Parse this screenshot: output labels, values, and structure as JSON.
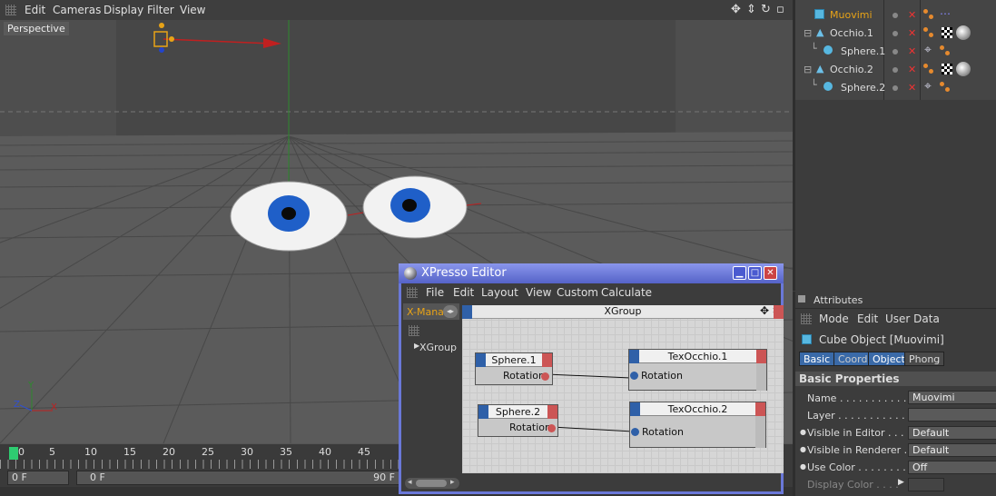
{
  "viewport": {
    "menu": [
      "Edit",
      "Cameras",
      "Display",
      "Filter",
      "View"
    ],
    "label": "Perspective"
  },
  "timeline": {
    "ticks": [
      "0",
      "5",
      "10",
      "15",
      "20",
      "25",
      "30",
      "35",
      "40",
      "45"
    ],
    "current_frame": "0 F",
    "start_frame": "0 F",
    "end_frame": "90 F"
  },
  "object_manager": {
    "objects": [
      {
        "name": "Muovimi",
        "type": "cube",
        "highlight": true
      },
      {
        "name": "Occhio.1",
        "type": "cone"
      },
      {
        "name": "Sphere.1",
        "type": "sphere"
      },
      {
        "name": "Occhio.2",
        "type": "cone"
      },
      {
        "name": "Sphere.2",
        "type": "sphere"
      }
    ]
  },
  "attributes": {
    "title": "Attributes",
    "menu": [
      "Mode",
      "Edit",
      "User Data"
    ],
    "object_title": "Cube Object [Muovimi]",
    "tabs": [
      "Basic",
      "Coord.",
      "Object",
      "Phong"
    ],
    "section": "Basic Properties",
    "fields": [
      {
        "label": "Name . . . . . . . . . . . .",
        "value": "Muovimi"
      },
      {
        "label": "Layer . . . . . . . . . . . .",
        "value": ""
      },
      {
        "label": "Visible in Editor . . .",
        "value": "Default"
      },
      {
        "label": "Visible in Renderer . .",
        "value": "Default"
      },
      {
        "label": "Use Color . . . . . . . .",
        "value": "Off"
      },
      {
        "label": "Display Color . . . .",
        "value": ""
      }
    ]
  },
  "xpresso": {
    "title": "XPresso Editor",
    "menu": [
      "File",
      "Edit",
      "Layout",
      "View",
      "Custom",
      "Calculate"
    ],
    "side_tab": "X-Mana",
    "tree_item": "XGroup",
    "group_title": "XGroup",
    "nodes": [
      {
        "title": "Sphere.1",
        "port": "Rotation"
      },
      {
        "title": "TexOcchio.1",
        "port": "Rotation"
      },
      {
        "title": "Sphere.2",
        "port": "Rotation"
      },
      {
        "title": "TexOcchio.2",
        "port": "Rotation"
      }
    ]
  },
  "colors": {
    "accent": "#e8a317",
    "port_in": "#2f60a8",
    "port_out": "#cc5555",
    "xpresso_frame": "#6a78d8"
  }
}
